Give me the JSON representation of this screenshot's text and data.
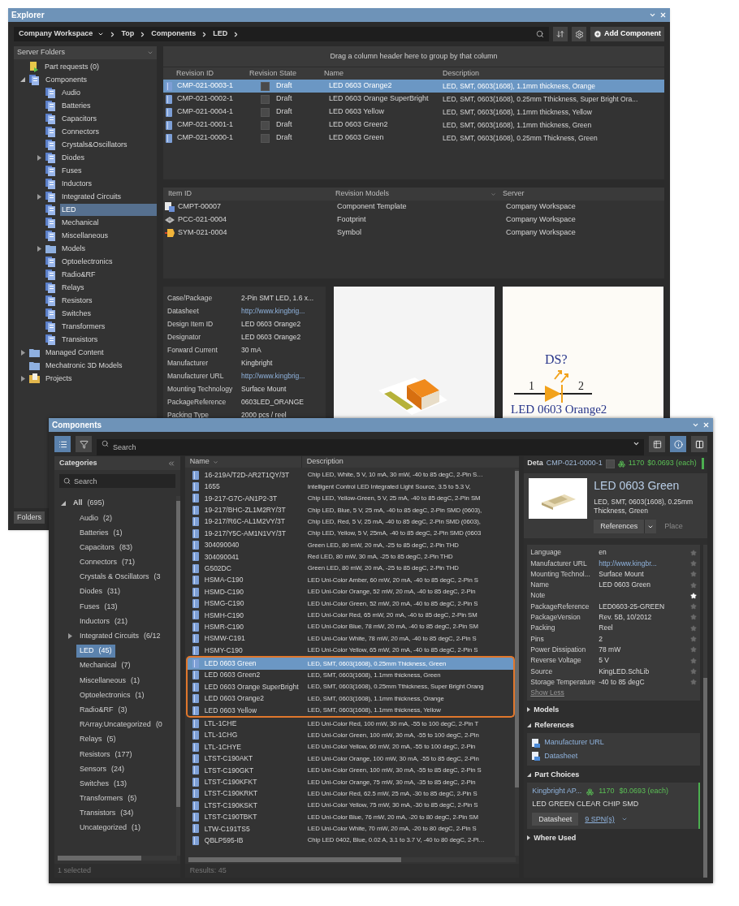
{
  "explorer": {
    "title": "Explorer",
    "breadcrumb": [
      {
        "label": "Company Workspace",
        "dropdown": true
      },
      {
        "label": "Top",
        "dropdown": false
      },
      {
        "label": "Components",
        "dropdown": false
      },
      {
        "label": "LED",
        "dropdown": false
      }
    ],
    "add_button": "Add Component",
    "folders_header": "Server Folders",
    "tree": [
      {
        "label": "Part requests (0)",
        "kind": "request",
        "selected": false
      },
      {
        "label": "Components",
        "kind": "category",
        "expanded": true,
        "selected": false,
        "children": [
          {
            "label": "Audio",
            "kind": "category",
            "selected": false
          },
          {
            "label": "Batteries",
            "kind": "category",
            "selected": false
          },
          {
            "label": "Capacitors",
            "kind": "category",
            "selected": false
          },
          {
            "label": "Connectors",
            "kind": "category",
            "selected": false
          },
          {
            "label": "Crystals&Oscillators",
            "kind": "category",
            "selected": false
          },
          {
            "label": "Diodes",
            "kind": "category",
            "expanded": false,
            "selected": false
          },
          {
            "label": "Fuses",
            "kind": "category",
            "selected": false
          },
          {
            "label": "Inductors",
            "kind": "category",
            "selected": false
          },
          {
            "label": "Integrated Circuits",
            "kind": "category",
            "expanded": false,
            "selected": false
          },
          {
            "label": "LED",
            "kind": "category",
            "selected": true
          },
          {
            "label": "Mechanical",
            "kind": "category",
            "selected": false
          },
          {
            "label": "Miscellaneous",
            "kind": "category",
            "selected": false
          },
          {
            "label": "Models",
            "kind": "folder",
            "expanded": false,
            "selected": false
          },
          {
            "label": "Optoelectronics",
            "kind": "category",
            "selected": false
          },
          {
            "label": "Radio&RF",
            "kind": "category",
            "selected": false
          },
          {
            "label": "Relays",
            "kind": "category",
            "selected": false
          },
          {
            "label": "Resistors",
            "kind": "category",
            "selected": false
          },
          {
            "label": "Switches",
            "kind": "category",
            "selected": false
          },
          {
            "label": "Transformers",
            "kind": "category",
            "selected": false
          },
          {
            "label": "Transistors",
            "kind": "category",
            "selected": false
          }
        ]
      },
      {
        "label": "Managed Content",
        "kind": "folder",
        "expanded": false,
        "selected": false
      },
      {
        "label": "Mechatronic 3D Models",
        "kind": "folder",
        "selected": false
      },
      {
        "label": "Projects",
        "kind": "project",
        "expanded": false,
        "selected": false
      }
    ],
    "folders_tab": "Folders",
    "group_hint": "Drag a column header here to group by that column",
    "revisions": {
      "columns": [
        "Revision ID",
        "Revision State",
        "Name",
        "Description"
      ],
      "rows": [
        {
          "revision_id": "CMP-021-0003-1",
          "checked": false,
          "state": "Draft",
          "name": "LED 0603 Orange2",
          "description": "LED, SMT, 0603(1608), 1.1mm thickness, Orange",
          "selected": true
        },
        {
          "revision_id": "CMP-021-0002-1",
          "checked": false,
          "state": "Draft",
          "name": "LED 0603 Orange SuperBright",
          "description": "LED, SMT, 0603(1608), 0.25mm Tthickness, Super Bright Ora...",
          "selected": false
        },
        {
          "revision_id": "CMP-021-0004-1",
          "checked": false,
          "state": "Draft",
          "name": "LED 0603 Yellow",
          "description": "LED, SMT, 0603(1608), 1.1mm thickness, Yellow",
          "selected": false
        },
        {
          "revision_id": "CMP-021-0001-1",
          "checked": false,
          "state": "Draft",
          "name": "LED 0603 Green2",
          "description": "LED, SMT, 0603(1608), 1.1mm thickness, Green",
          "selected": false
        },
        {
          "revision_id": "CMP-021-0000-1",
          "checked": false,
          "state": "Draft",
          "name": "LED 0603 Green",
          "description": "LED, SMT, 0603(1608), 0.25mm Thickness, Green",
          "selected": false
        }
      ]
    },
    "items": {
      "columns": [
        "Item ID",
        "Revision Models",
        "Server"
      ],
      "rows": [
        {
          "item_id": "CMPT-00007",
          "kind": "template",
          "model": "Component Template",
          "server": "Company Workspace"
        },
        {
          "item_id": "PCC-021-0004",
          "kind": "footprint",
          "model": "Footprint",
          "server": "Company Workspace"
        },
        {
          "item_id": "SYM-021-0004",
          "kind": "symbol",
          "model": "Symbol",
          "server": "Company Workspace"
        }
      ]
    },
    "properties": [
      {
        "label": "Case/Package",
        "value": "2-Pin SMT LED, 1.6 x...",
        "kind": "text"
      },
      {
        "label": "Datasheet",
        "value": "http://www.kingbrig...",
        "kind": "link"
      },
      {
        "label": "Design Item ID",
        "value": "LED 0603 Orange2",
        "kind": "text"
      },
      {
        "label": "Designator",
        "value": "LED 0603 Orange2",
        "kind": "text"
      },
      {
        "label": "Forward Current",
        "value": "30 mA",
        "kind": "text"
      },
      {
        "label": "Manufacturer",
        "value": "Kingbright",
        "kind": "text"
      },
      {
        "label": "Manufacturer URL",
        "value": "http://www.kingbrig...",
        "kind": "link"
      },
      {
        "label": "Mounting Technology",
        "value": "Surface Mount",
        "kind": "text"
      },
      {
        "label": "PackageReference",
        "value": "0603LED_ORANGE",
        "kind": "text"
      },
      {
        "label": "Packing Type",
        "value": "2000 pcs / reel",
        "kind": "text"
      }
    ],
    "symbol": {
      "designator": "DS?",
      "pin_1": "1",
      "pin_2": "2",
      "name": "LED 0603 Orange2"
    }
  },
  "components": {
    "title": "Components",
    "search_placeholder": "Search",
    "categories": {
      "header": "Categories",
      "search_placeholder": "Search",
      "status": "1 selected",
      "tree": [
        {
          "name": "All",
          "count": "(695)",
          "expanded": true,
          "selected": false,
          "children": [
            {
              "name": "Audio",
              "count": "(2)",
              "selected": false
            },
            {
              "name": "Batteries",
              "count": "(1)",
              "selected": false
            },
            {
              "name": "Capacitors",
              "count": "(83)",
              "selected": false
            },
            {
              "name": "Connectors",
              "count": "(71)",
              "selected": false
            },
            {
              "name": "Crystals & Oscillators",
              "count": "(3",
              "selected": false
            },
            {
              "name": "Diodes",
              "count": "(31)",
              "selected": false
            },
            {
              "name": "Fuses",
              "count": "(13)",
              "selected": false
            },
            {
              "name": "Inductors",
              "count": "(21)",
              "selected": false
            },
            {
              "name": "Integrated Circuits",
              "count": "(6/12",
              "expanded": false,
              "selected": false
            },
            {
              "name": "LED",
              "count": "(45)",
              "selected": true
            },
            {
              "name": "Mechanical",
              "count": "(7)",
              "selected": false
            },
            {
              "name": "Miscellaneous",
              "count": "(1)",
              "selected": false
            },
            {
              "name": "Optoelectronics",
              "count": "(1)",
              "selected": false
            },
            {
              "name": "Radio&RF",
              "count": "(3)",
              "selected": false
            },
            {
              "name": "RArray.Uncategorized",
              "count": "(0",
              "selected": false
            },
            {
              "name": "Relays",
              "count": "(5)",
              "selected": false
            },
            {
              "name": "Resistors",
              "count": "(177)",
              "selected": false
            },
            {
              "name": "Sensors",
              "count": "(24)",
              "selected": false
            },
            {
              "name": "Switches",
              "count": "(13)",
              "selected": false
            },
            {
              "name": "Transformers",
              "count": "(5)",
              "selected": false
            },
            {
              "name": "Transistors",
              "count": "(34)",
              "selected": false
            },
            {
              "name": "Uncategorized",
              "count": "(1)",
              "selected": false
            }
          ]
        }
      ]
    },
    "list": {
      "columns": [
        "Name",
        "Description"
      ],
      "results": "Results: 45",
      "rows": [
        {
          "name": "16-219A/T2D-AR2T1QY/3T",
          "description": "Chip LED, White, 5 V, 10 mA, 30 mW, -40 to 85 degC, 2-Pin S…",
          "selected": false,
          "highlighted": false
        },
        {
          "name": "1655",
          "description": "Intelligent Control LED Integrated Light Source, 3.5 to 5.3 V,",
          "selected": false,
          "highlighted": false
        },
        {
          "name": "19-217-G7C-AN1P2-3T",
          "description": "Chip LED, Yellow-Green, 5 V, 25 mA, -40 to 85 degC, 2-Pin SM",
          "selected": false,
          "highlighted": false
        },
        {
          "name": "19-217/BHC-ZL1M2RY/3T",
          "description": "Chip LED, Blue, 5 V, 25 mA, -40 to 85 degC, 2-Pin SMD (0603),",
          "selected": false,
          "highlighted": false
        },
        {
          "name": "19-217/R6C-AL1M2VY/3T",
          "description": "Chip LED, Red, 5 V, 25 mA, -40 to 85 degC, 2-Pin SMD (0603),",
          "selected": false,
          "highlighted": false
        },
        {
          "name": "19-217/Y5C-AM1N1VY/3T",
          "description": "Chip LED, Yellow, 5 V, 25mA, -40 to 85 degC, 2-Pin SMD (0603",
          "selected": false,
          "highlighted": false
        },
        {
          "name": "304090040",
          "description": "Green LED, 80 mW, 20 mA, -25 to 85 degC, 2-Pin THD",
          "selected": false,
          "highlighted": false
        },
        {
          "name": "304090041",
          "description": "Red LED, 80 mW, 30 mA, -25 to 85 degC, 2-Pin THD",
          "selected": false,
          "highlighted": false
        },
        {
          "name": "G502DC",
          "description": "Green LED, 80 mW, 20 mA, -25 to 85 degC, 2-Pin THD",
          "selected": false,
          "highlighted": false
        },
        {
          "name": "HSMA-C190",
          "description": "LED Uni-Color Amber, 60 mW, 20 mA, -40 to 85 degC, 2-Pin S",
          "selected": false,
          "highlighted": false
        },
        {
          "name": "HSMD-C190",
          "description": "LED Uni-Color Orange, 52 mW, 20 mA, -40 to 85 degC, 2-Pin",
          "selected": false,
          "highlighted": false
        },
        {
          "name": "HSMG-C190",
          "description": "LED Uni-Color Green, 52 mW, 20 mA, -40 to 85 degC, 2-Pin S",
          "selected": false,
          "highlighted": false
        },
        {
          "name": "HSMH-C190",
          "description": "LED Uni-Color Red, 65 mW, 20 mA, -40 to 85 degC, 2-Pin SM",
          "selected": false,
          "highlighted": false
        },
        {
          "name": "HSMR-C190",
          "description": "LED Uni-Color Blue, 78 mW, 20 mA, -40 to 85 degC, 2-Pin SM",
          "selected": false,
          "highlighted": false
        },
        {
          "name": "HSMW-C191",
          "description": "LED Uni-Color White, 78 mW, 20 mA, -40 to 85 degC, 2-Pin S",
          "selected": false,
          "highlighted": false
        },
        {
          "name": "HSMY-C190",
          "description": "LED Uni-Color Yellow, 65 mW, 20 mA, -40 to 85 degC, 2-Pin S",
          "selected": false,
          "highlighted": false
        },
        {
          "name": "LED 0603 Green",
          "description": "LED, SMT, 0603(1608), 0.25mm Thickness, Green",
          "selected": true,
          "highlighted": true
        },
        {
          "name": "LED 0603 Green2",
          "description": "LED, SMT, 0603(1608), 1.1mm thickness, Green",
          "selected": false,
          "highlighted": true
        },
        {
          "name": "LED 0603 Orange SuperBright",
          "description": "LED, SMT, 0603(1608), 0.25mm Tthickness, Super Bright Orang",
          "selected": false,
          "highlighted": true
        },
        {
          "name": "LED 0603 Orange2",
          "description": "LED, SMT, 0603(1608), 1.1mm thickness, Orange",
          "selected": false,
          "highlighted": true
        },
        {
          "name": "LED 0603 Yellow",
          "description": "LED, SMT, 0603(1608), 1.1mm thickness, Yellow",
          "selected": false,
          "highlighted": true
        },
        {
          "name": "LTL-1CHE",
          "description": "LED Uni-Color Red, 100 mW, 30 mA, -55 to 100 degC, 2-Pin T",
          "selected": false,
          "highlighted": false
        },
        {
          "name": "LTL-1CHG",
          "description": "LED Uni-Color Green, 100 mW, 30 mA, -55 to 100 degC, 2-Pin",
          "selected": false,
          "highlighted": false
        },
        {
          "name": "LTL-1CHYE",
          "description": "LED Uni-Color Yellow, 60 mW, 20 mA, -55 to 100 degC, 2-Pin",
          "selected": false,
          "highlighted": false
        },
        {
          "name": "LTST-C190AKT",
          "description": "LED Uni-Color Orange, 100 mW, 30 mA, -55 to 85 degC, 2-Pin",
          "selected": false,
          "highlighted": false
        },
        {
          "name": "LTST-C190GKT",
          "description": "LED Uni-Color Green, 100 mW, 30 mA, -55 to 85 degC, 2-Pin S",
          "selected": false,
          "highlighted": false
        },
        {
          "name": "LTST-C190KFKT",
          "description": "LED Uni-Color Orange, 75 mW, 30 mA, -35 to 85 degC, 2-Pin",
          "selected": false,
          "highlighted": false
        },
        {
          "name": "LTST-C190KRKT",
          "description": "LED Uni-Color Red, 62.5 mW, 25 mA, -30 to 85 degC, 2-Pin S",
          "selected": false,
          "highlighted": false
        },
        {
          "name": "LTST-C190KSKT",
          "description": "LED Uni-Color Yellow, 75 mW, 30 mA, -30 to 85 degC, 2-Pin S",
          "selected": false,
          "highlighted": false
        },
        {
          "name": "LTST-C190TBKT",
          "description": "LED Uni-Color Blue, 76 mW, 20 mA, -20 to 80 degC, 2-Pin SM",
          "selected": false,
          "highlighted": false
        },
        {
          "name": "LTW-C191TS5",
          "description": "LED Uni-Color White, 70 mW, 20 mA, -20 to 80 degC, 2-Pin S",
          "selected": false,
          "highlighted": false
        },
        {
          "name": "QBLP595-IB",
          "description": "Chip LED 0402, Blue, 0.02 A, 3.1 to 3.7 V, -40 to 80 degC, 2-Pi…",
          "selected": false,
          "highlighted": false
        }
      ]
    },
    "details": {
      "label": "Deta",
      "revision_id": "CMP-021-0000-1",
      "checked": false,
      "stock": "1170",
      "price": "$0.0693 (each)",
      "name": "LED 0603 Green",
      "description": "LED, SMT, 0603(1608), 0.25mm Thickness, Green",
      "references_button": "References",
      "place_button": "Place",
      "place_disabled": true,
      "properties": [
        {
          "label": "Language",
          "value": "en",
          "kind": "text",
          "starred": false
        },
        {
          "label": "Manufacturer URL",
          "value": "http://www.kingbr...",
          "kind": "link",
          "starred": false
        },
        {
          "label": "Mounting Technol...",
          "value": "Surface Mount",
          "kind": "text",
          "starred": false
        },
        {
          "label": "Name",
          "value": "LED 0603 Green",
          "kind": "text",
          "starred": false
        },
        {
          "label": "Note",
          "kind": "text",
          "starred": true
        },
        {
          "label": "PackageReference",
          "value": "LED0603-25-GREEN",
          "kind": "text",
          "starred": false
        },
        {
          "label": "PackageVersion",
          "value": "Rev. 5B, 10/2012",
          "kind": "text",
          "starred": false
        },
        {
          "label": "Packing",
          "value": "Reel",
          "kind": "text",
          "starred": false
        },
        {
          "label": "Pins",
          "value": "2",
          "kind": "text",
          "starred": false
        },
        {
          "label": "Power Dissipation",
          "value": "78 mW",
          "kind": "text",
          "starred": false
        },
        {
          "label": "Reverse Voltage",
          "value": "5 V",
          "kind": "text",
          "starred": false
        },
        {
          "label": "Source",
          "value": "KingLED.SchLib",
          "kind": "text",
          "starred": false
        },
        {
          "label": "Storage Temperature",
          "value": "-40 to 85 degC",
          "kind": "text",
          "starred": false
        }
      ],
      "show_less": "Show Less",
      "sections": [
        {
          "title": "Models",
          "expanded": false
        },
        {
          "kind": "links",
          "title": "References",
          "expanded": true,
          "links": [
            "Manufacturer URL",
            "Datasheet"
          ]
        },
        {
          "kind": "choices",
          "title": "Part Choices",
          "expanded": true,
          "supplier": "Kingbright AP...",
          "stock": "1170",
          "price": "$0.0693 (each)",
          "part": "LED GREEN CLEAR CHIP SMD",
          "button": "Datasheet",
          "spn": "9 SPN(s)"
        },
        {
          "title": "Where Used",
          "expanded": false
        }
      ]
    }
  }
}
